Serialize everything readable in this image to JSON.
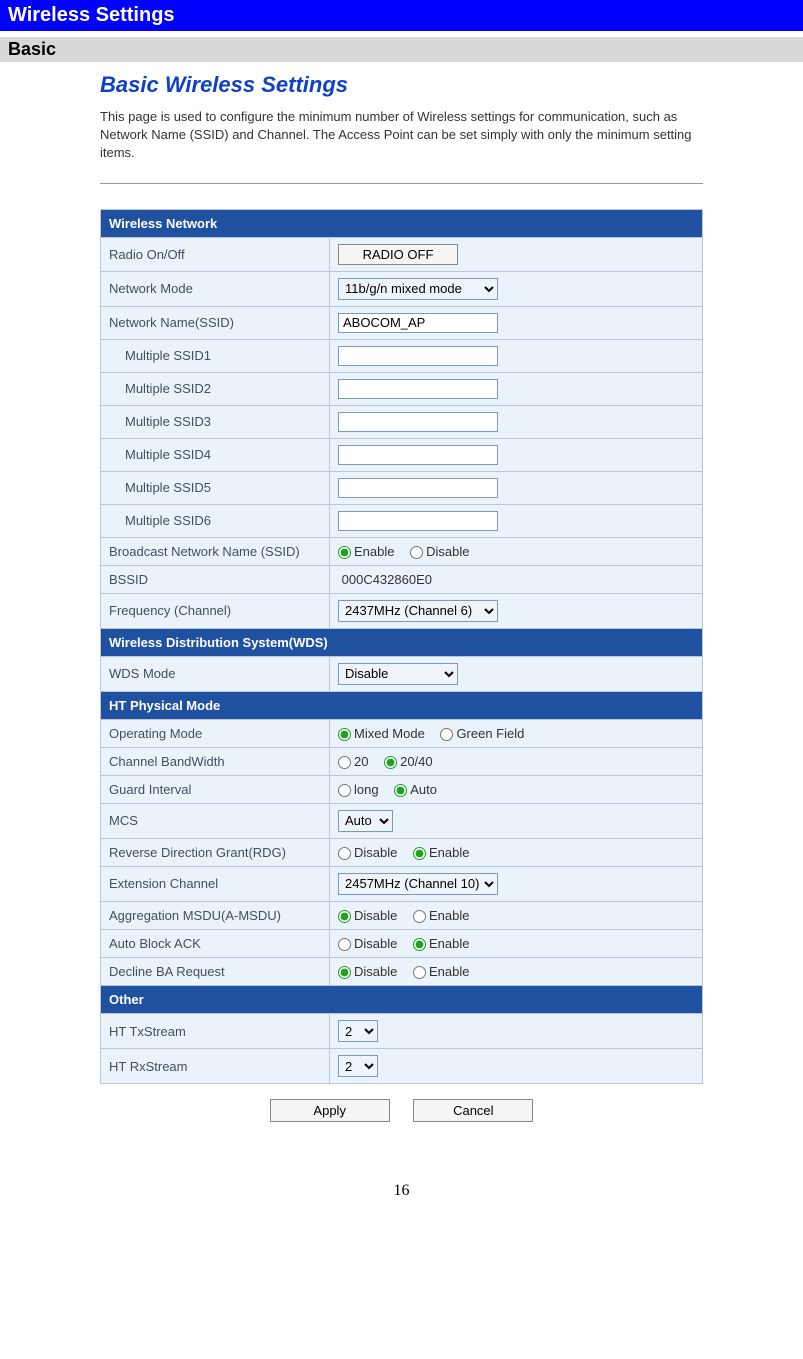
{
  "header": {
    "title": "Wireless Settings",
    "sub": "Basic"
  },
  "page": {
    "title": "Basic Wireless Settings",
    "desc": "This page is used to configure the minimum number of Wireless settings for communication, such as Network Name (SSID) and Channel. The Access Point can be set simply with only the minimum setting items."
  },
  "sections": {
    "wireless_network": "Wireless Network",
    "wds": "Wireless Distribution System(WDS)",
    "ht": "HT Physical Mode",
    "other": "Other"
  },
  "labels": {
    "radio": "Radio On/Off",
    "network_mode": "Network Mode",
    "ssid": "Network Name(SSID)",
    "mssid1": "Multiple SSID1",
    "mssid2": "Multiple SSID2",
    "mssid3": "Multiple SSID3",
    "mssid4": "Multiple SSID4",
    "mssid5": "Multiple SSID5",
    "mssid6": "Multiple SSID6",
    "broadcast": "Broadcast Network Name (SSID)",
    "bssid": "BSSID",
    "freq": "Frequency (Channel)",
    "wds_mode": "WDS Mode",
    "op_mode": "Operating Mode",
    "bw": "Channel BandWidth",
    "guard": "Guard Interval",
    "mcs": "MCS",
    "rdg": "Reverse Direction Grant(RDG)",
    "ext": "Extension Channel",
    "amsdu": "Aggregation MSDU(A-MSDU)",
    "block_ack": "Auto Block ACK",
    "decline_ba": "Decline BA Request",
    "tx": "HT TxStream",
    "rx": "HT RxStream"
  },
  "values": {
    "radio_btn": "RADIO OFF",
    "network_mode": "11b/g/n mixed mode",
    "ssid": "ABOCOM_AP",
    "mssid1": "",
    "mssid2": "",
    "mssid3": "",
    "mssid4": "",
    "mssid5": "",
    "mssid6": "",
    "bssid": "000C432860E0",
    "freq": "2437MHz (Channel 6)",
    "wds_mode": "Disable",
    "mcs": "Auto",
    "ext": "2457MHz (Channel 10)",
    "tx": "2",
    "rx": "2"
  },
  "radios": {
    "enable": "Enable",
    "disable": "Disable",
    "mixed": "Mixed Mode",
    "green": "Green Field",
    "bw20": "20",
    "bw2040": "20/40",
    "long": "long",
    "auto": "Auto"
  },
  "buttons": {
    "apply": "Apply",
    "cancel": "Cancel"
  },
  "page_number": "16"
}
